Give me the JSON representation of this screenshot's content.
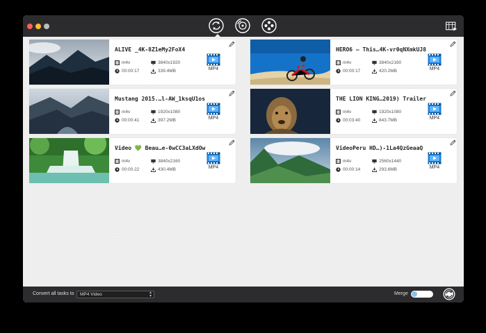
{
  "window": {
    "traffic_lights": [
      {
        "name": "close",
        "color": "#ff5f57"
      },
      {
        "name": "minimize",
        "color": "#febc2e"
      },
      {
        "name": "zoom",
        "color": "#bdbdbd"
      }
    ]
  },
  "toolbar": {
    "icons": [
      "convert-icon",
      "dvd-icon",
      "video-reel-icon"
    ],
    "right_icon": "media-library-icon"
  },
  "videos": [
    {
      "title": "ALIVE _4K-8Z1eMy2FoX4",
      "container": "m4v",
      "resolution": "3840x1920",
      "duration": "00:00:17",
      "size": "339.4MB",
      "format": "MP4",
      "thumb": "mountains"
    },
    {
      "title": "HERO6 – This…4K-vr0qNXmkUJ8",
      "container": "m4v",
      "resolution": "3840x2160",
      "duration": "00:00:17",
      "size": "420.2MB",
      "format": "MP4",
      "thumb": "motocross"
    },
    {
      "title": "Mustang 2015.…l-AW_1ksqU1os",
      "container": "m4v",
      "resolution": "1920x1080",
      "duration": "00:00:41",
      "size": "397.2MB",
      "format": "MP4",
      "thumb": "valley"
    },
    {
      "title": "THE LION KING…2019) Trailer",
      "container": "m4v",
      "resolution": "1920x1080",
      "duration": "00:03:40",
      "size": "843.7MB",
      "format": "MP4",
      "thumb": "lion"
    },
    {
      "title": "Video 💚 Beau…e-0wCC3aLXdOw",
      "container": "m4v",
      "resolution": "3840x2160",
      "duration": "00:00:22",
      "size": "430.4MB",
      "format": "MP4",
      "thumb": "waterfall"
    },
    {
      "title": "VideoPeru  HD…)-1La4QzGeaaQ",
      "container": "m4v",
      "resolution": "2560x1440",
      "duration": "00:00:14",
      "size": "293.6MB",
      "format": "MP4",
      "thumb": "peru"
    }
  ],
  "footer": {
    "convert_label": "Convert all tasks to",
    "convert_value": "MP4 Video",
    "merge_label": "Merge",
    "merge_on": false,
    "accent": "#8cbfe8"
  }
}
